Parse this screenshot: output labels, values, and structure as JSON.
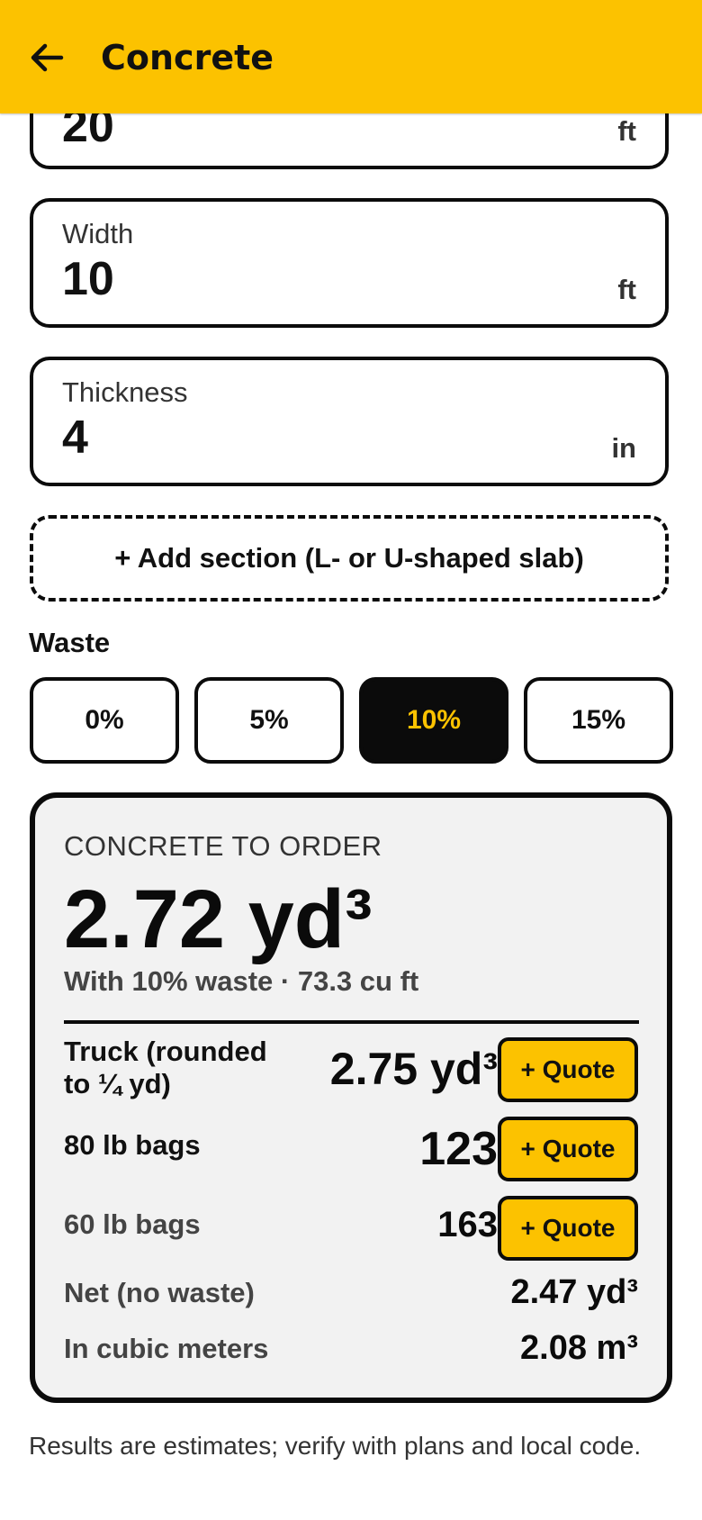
{
  "header": {
    "title": "Concrete",
    "back_icon": "arrow-left-icon"
  },
  "fields": {
    "length": {
      "value": "20",
      "unit": "ft"
    },
    "width": {
      "label": "Width",
      "value": "10",
      "unit": "ft"
    },
    "thickness": {
      "label": "Thickness",
      "value": "4",
      "unit": "in"
    }
  },
  "add_section_label": "+ Add section (L- or U-shaped slab)",
  "waste": {
    "label": "Waste",
    "options": [
      "0%",
      "5%",
      "10%",
      "15%"
    ],
    "selected": "10%"
  },
  "result": {
    "heading": "CONCRETE TO ORDER",
    "total": "2.72 yd³",
    "subtitle": "With 10% waste · 73.3 cu ft",
    "rows": {
      "truck": {
        "label": "Truck (rounded to ¼ yd)",
        "value": "2.75 yd³",
        "button": "+ Quote"
      },
      "bags80": {
        "label": "80 lb bags",
        "value": "123",
        "button": "+ Quote"
      },
      "bags60": {
        "label": "60 lb bags",
        "value": "163",
        "button": "+ Quote"
      },
      "net": {
        "label": "Net (no waste)",
        "value": "2.47 yd³"
      },
      "metric": {
        "label": "In cubic meters",
        "value": "2.08 m³"
      }
    }
  },
  "disclaimer": "Results are estimates; verify with plans and local code.",
  "colors": {
    "accent": "#FCC200",
    "ink": "#0b0b0b",
    "card": "#f2f2f2"
  }
}
